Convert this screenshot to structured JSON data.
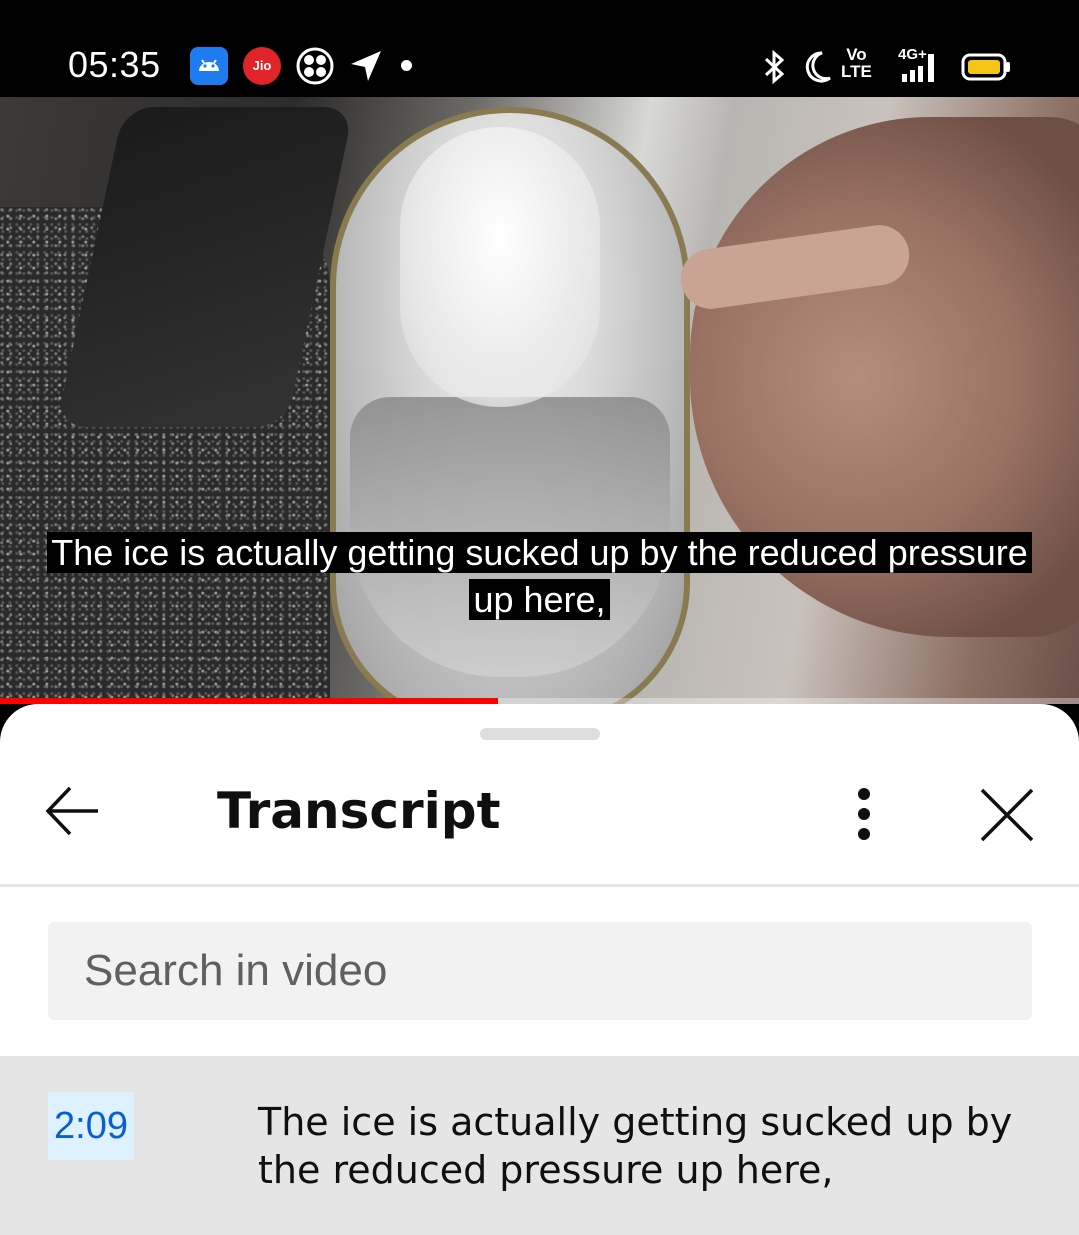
{
  "status_bar": {
    "time": "05:35",
    "app_icons": [
      "android-icon",
      "jio-icon",
      "fan-icon",
      "location-arrow-icon",
      "notification-dot"
    ],
    "jio_label": "Jio",
    "system_icons": [
      "bluetooth-icon",
      "do-not-disturb-moon-icon",
      "volte-icon",
      "signal-4g-icon",
      "battery-icon"
    ],
    "volte_top": "Vo",
    "volte_bottom": "LTE",
    "network": "4G+",
    "battery_color": "#f5c518"
  },
  "video": {
    "caption_line1": "The ice is actually getting sucked up by the reduced pressure",
    "caption_line2": "up here,",
    "progress_fraction": 0.462,
    "progress_color": "#ff0000"
  },
  "transcript_panel": {
    "title": "Transcript",
    "search_placeholder": "Search in video",
    "segments": [
      {
        "timestamp": "2:09",
        "text": "The ice is actually getting sucked up by the reduced pressure up here,",
        "active": true
      }
    ],
    "accent_color": "#065fd4"
  }
}
